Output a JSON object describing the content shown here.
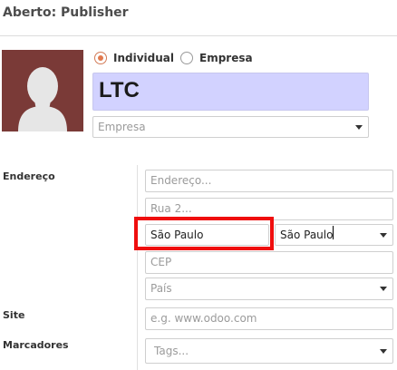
{
  "header": {
    "title": "Aberto: Publisher"
  },
  "partner_type": {
    "options": [
      {
        "label": "Individual",
        "checked": true
      },
      {
        "label": "Empresa",
        "checked": false
      }
    ]
  },
  "name": {
    "value": "LTC"
  },
  "company": {
    "placeholder": "Empresa"
  },
  "address": {
    "label": "Endereço",
    "street_placeholder": "Endereço...",
    "street2_placeholder": "Rua 2...",
    "city_value": "São Paulo",
    "state_value": "São Paulo",
    "zip_placeholder": "CEP",
    "country_placeholder": "País"
  },
  "website": {
    "label": "Site",
    "placeholder": "e.g. www.odoo.com"
  },
  "tags": {
    "label": "Marcadores",
    "placeholder": "Tags..."
  },
  "colors": {
    "accent": "#e2794d",
    "name_bg": "#d2d2ff",
    "highlight": "#ef0e0e",
    "avatar_bg": "#7a3a37"
  }
}
